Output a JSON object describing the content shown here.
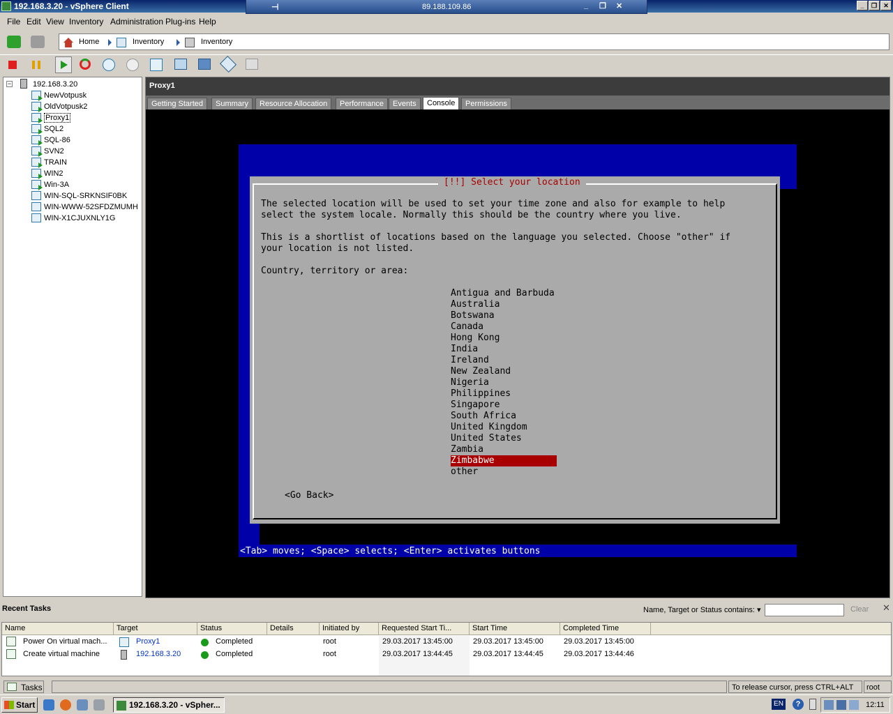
{
  "window": {
    "title": "192.168.3.20 - vSphere Client",
    "rdp_ip": "89.188.109.86"
  },
  "menu": [
    "File",
    "Edit",
    "View",
    "Inventory",
    "Administration",
    "Plug-ins",
    "Help"
  ],
  "breadcrumb": {
    "home": "Home",
    "inventory1": "Inventory",
    "inventory2": "Inventory"
  },
  "tree": {
    "host": "192.168.3.20",
    "vms": [
      {
        "name": "NewVotpusk",
        "powered_on": true
      },
      {
        "name": "OldVotpusk2",
        "powered_on": true
      },
      {
        "name": "Proxy1",
        "powered_on": true,
        "selected": true
      },
      {
        "name": "SQL2",
        "powered_on": true
      },
      {
        "name": "SQL-86",
        "powered_on": true
      },
      {
        "name": "SVN2",
        "powered_on": true
      },
      {
        "name": "TRAIN",
        "powered_on": true
      },
      {
        "name": "WIN2",
        "powered_on": true
      },
      {
        "name": "Win-3A",
        "powered_on": true
      },
      {
        "name": "WIN-SQL-SRKNSIF0BK",
        "powered_on": false
      },
      {
        "name": "WIN-WWW-52SFDZMUMH",
        "powered_on": false
      },
      {
        "name": "WIN-X1CJUXNLY1G",
        "powered_on": false
      }
    ]
  },
  "object": {
    "title": "Proxy1",
    "tabs": [
      "Getting Started",
      "Summary",
      "Resource Allocation",
      "Performance",
      "Events",
      "Console",
      "Permissions"
    ],
    "active_tab": "Console"
  },
  "console": {
    "dialog_title": "[!!] Select your location",
    "para1_line1": "The selected location will be used to set your time zone and also for example to help",
    "para1_line2": "select the system locale. Normally this should be the country where you live.",
    "para2_line1": "This is a shortlist of locations based on the language you selected. Choose \"other\" if",
    "para2_line2": "your location is not listed.",
    "prompt": "Country, territory or area:",
    "locations": [
      "Antigua and Barbuda",
      "Australia",
      "Botswana",
      "Canada",
      "Hong Kong",
      "India",
      "Ireland",
      "New Zealand",
      "Nigeria",
      "Philippines",
      "Singapore",
      "South Africa",
      "United Kingdom",
      "United States",
      "Zambia",
      "Zimbabwe",
      "other"
    ],
    "selected_location": "Zimbabwe",
    "go_back": "<Go Back>",
    "help": "<Tab> moves; <Space> selects; <Enter> activates buttons",
    "colors": {
      "blue": "#0000a8",
      "dialog": "#aaaaaa",
      "title_red": "#a80000",
      "highlight": "#a80000"
    }
  },
  "recent_tasks": {
    "title": "Recent Tasks",
    "filter_label": "Name, Target or Status contains: ▾",
    "filter_value": "",
    "clear": "Clear",
    "columns": [
      "Name",
      "Target",
      "Status",
      "Details",
      "Initiated by",
      "Requested Start Ti...",
      "Start Time",
      "Completed Time"
    ],
    "rows": [
      {
        "name": "Power On virtual mach...",
        "target": "Proxy1",
        "status": "Completed",
        "details": "",
        "initiated_by": "root",
        "requested": "29.03.2017 13:45:00",
        "start": "29.03.2017 13:45:00",
        "completed": "29.03.2017 13:45:00"
      },
      {
        "name": "Create virtual machine",
        "target": "192.168.3.20",
        "status": "Completed",
        "details": "",
        "initiated_by": "root",
        "requested": "29.03.2017 13:44:45",
        "start": "29.03.2017 13:44:45",
        "completed": "29.03.2017 13:44:46"
      }
    ]
  },
  "statusbar": {
    "tasks": "Tasks",
    "message": "To release cursor, press CTRL+ALT",
    "user": "root"
  },
  "taskbar": {
    "start": "Start",
    "app": "192.168.3.20 - vSpher...",
    "lang": "EN",
    "clock": "12:11"
  }
}
